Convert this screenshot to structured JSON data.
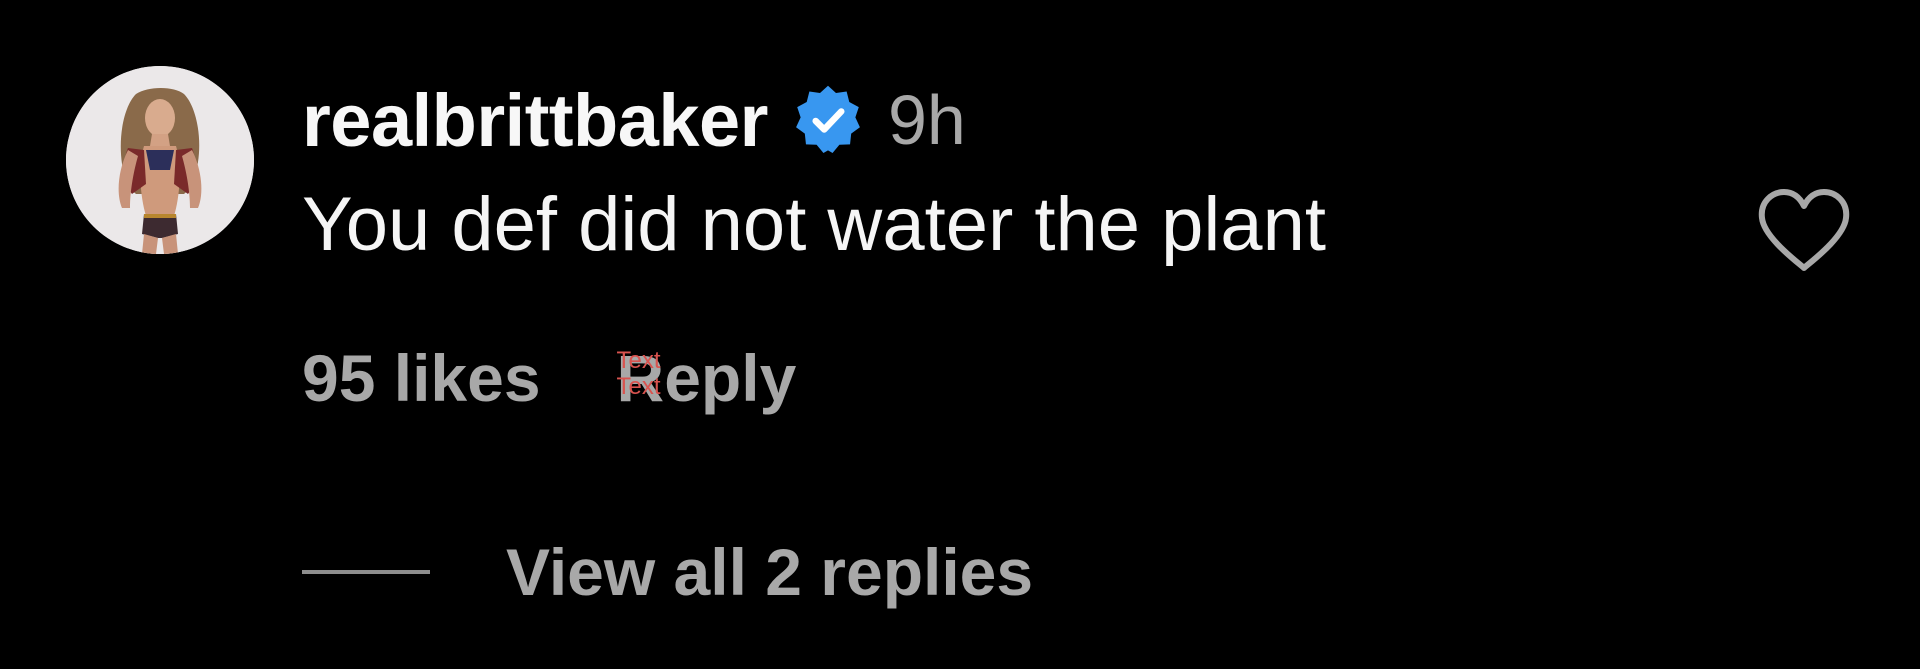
{
  "comment": {
    "username": "realbrittbaker",
    "verified": true,
    "timestamp": "9h",
    "text": "You def did not water the plant",
    "likes_label": "95 likes",
    "reply_label": "Reply",
    "reply_overlay_text": "Text",
    "view_replies_label": "View all 2 replies"
  },
  "icons": {
    "verified": "verified-badge-icon",
    "like": "heart-outline-icon"
  },
  "colors": {
    "background": "#000000",
    "primary_text": "#f5f5f5",
    "secondary_text": "#a8a8a8",
    "verified_blue": "#3897f0",
    "overlay_red": "#d9534f"
  }
}
